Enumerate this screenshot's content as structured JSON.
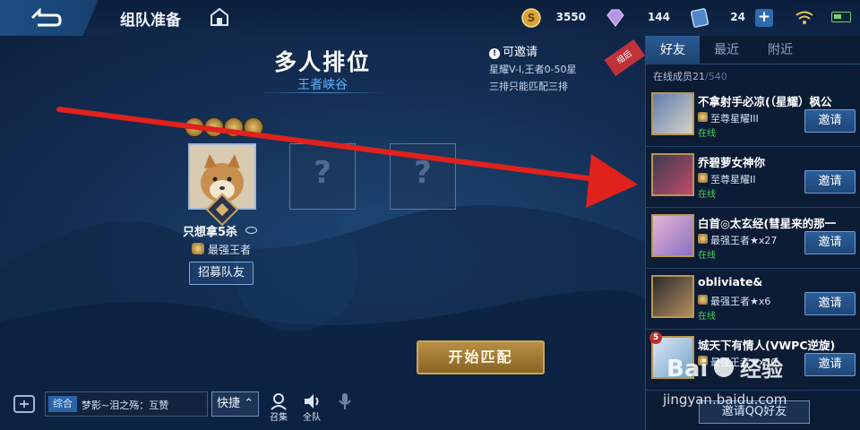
{
  "topbar": {
    "title": "组队准备",
    "gold": "3550",
    "gems": "144",
    "tickets": "24",
    "plus": "+"
  },
  "mode": {
    "title": "多人排位",
    "subtitle": "王者峡谷",
    "invite_head": "可邀请",
    "invite_line1": "星耀V-I,王者0-50星",
    "invite_line2": "三排只能匹配三排",
    "excl": "!"
  },
  "player": {
    "name": "只想拿5杀",
    "rank": "最强王者",
    "recruit": "招募队友"
  },
  "empty_slot_glyph": "?",
  "start_button": "开始匹配",
  "chat": {
    "tag": "综合",
    "message": "梦影~泪之殇：互赞",
    "quick": "快捷 ⌃",
    "rally": "召集",
    "all_team": "全队"
  },
  "panel": {
    "tabs": [
      "好友",
      "最近",
      "附近"
    ],
    "corner_tag": "组后",
    "online_label": "在线成员21",
    "online_total": "/540",
    "invite_qq": "邀请QQ好友",
    "friends": [
      {
        "name": "不拿射手必凉(（星耀）枫公",
        "rank": "至尊星耀III",
        "status": "在线",
        "invite": "邀请",
        "level": ""
      },
      {
        "name": "乔碧萝女神你",
        "rank": "至尊星耀II",
        "status": "在线",
        "invite": "邀请",
        "level": ""
      },
      {
        "name": "白首◎太玄经(彗星来的那一",
        "rank": "最强王者★x27",
        "status": "在线",
        "invite": "邀请",
        "level": ""
      },
      {
        "name": "obliviate&",
        "rank": "最强王者★x6",
        "status": "在线",
        "invite": "邀请",
        "level": ""
      },
      {
        "name": "城天下有情人(VWPC逆旋)",
        "rank": "最强王者★x50",
        "status": "",
        "invite": "邀请",
        "level": "5"
      }
    ]
  },
  "watermark": {
    "logo": "Bai 经验",
    "url": "jingyan.baidu.com"
  },
  "colors": {
    "accent": "#2b5d99",
    "online": "#46d45a",
    "start_gold": "#b88f43",
    "arrow": "#e0211c"
  },
  "icons": [
    "back-icon",
    "home-icon",
    "gold-coin-icon",
    "gem-icon",
    "ticket-icon",
    "wifi-icon",
    "battery-icon",
    "voice-icon",
    "rally-icon",
    "speaker-icon",
    "mic-icon",
    "eye-icon"
  ]
}
